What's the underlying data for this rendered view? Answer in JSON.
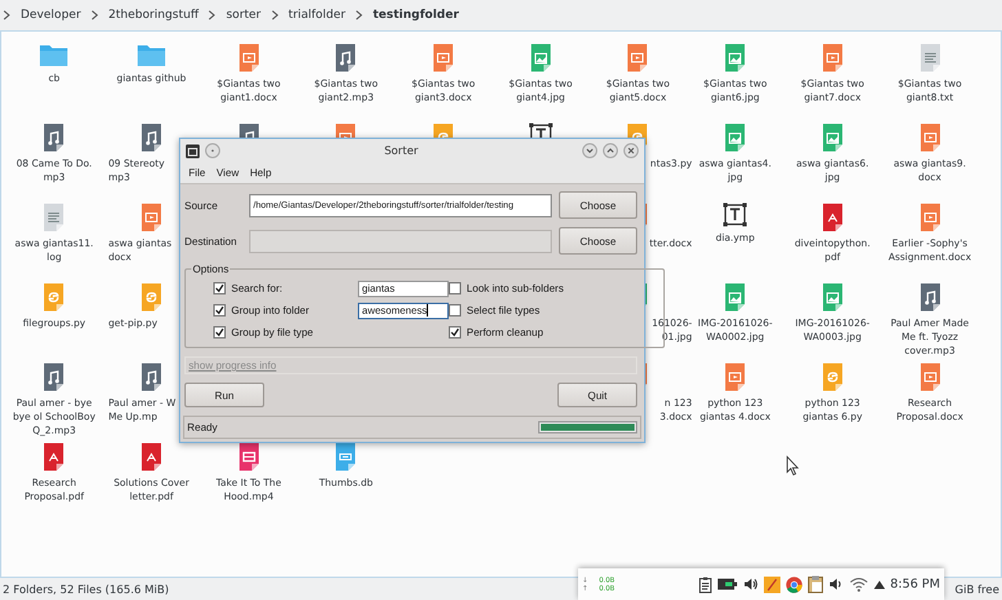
{
  "breadcrumb": [
    {
      "label": "Developer",
      "selected": false
    },
    {
      "label": "2theboringstuff",
      "selected": false
    },
    {
      "label": "sorter",
      "selected": false
    },
    {
      "label": "trialfolder",
      "selected": false
    },
    {
      "label": "testingfolder",
      "selected": true
    }
  ],
  "rows": [
    [
      {
        "kind": "folder",
        "lines": [
          "cb"
        ]
      },
      {
        "kind": "folder",
        "lines": [
          "giantas github"
        ]
      },
      {
        "kind": "docx",
        "lines": [
          "$Giantas two",
          "giant1.docx"
        ]
      },
      {
        "kind": "mp3",
        "lines": [
          "$Giantas two",
          "giant2.mp3"
        ]
      },
      {
        "kind": "docx",
        "lines": [
          "$Giantas two",
          "giant3.docx"
        ]
      },
      {
        "kind": "jpg",
        "lines": [
          "$Giantas two",
          "giant4.jpg"
        ]
      },
      {
        "kind": "docx",
        "lines": [
          "$Giantas two",
          "giant5.docx"
        ]
      },
      {
        "kind": "jpg",
        "lines": [
          "$Giantas two",
          "giant6.jpg"
        ]
      },
      {
        "kind": "docx",
        "lines": [
          "$Giantas two",
          "giant7.docx"
        ]
      },
      {
        "kind": "txt",
        "lines": [
          "$Giantas two",
          "giant8.txt"
        ]
      }
    ],
    [
      {
        "kind": "mp3",
        "lines": [
          "08 Came To Do.",
          "mp3"
        ]
      },
      {
        "kind": "mp3",
        "lines": [
          "09 Stereoty",
          "mp3"
        ]
      },
      {
        "kind": "mp3"
      },
      {
        "kind": "docx"
      },
      {
        "kind": "py"
      },
      {
        "kind": "text"
      },
      {
        "kind": "py",
        "lines": [
          "ntas3.py"
        ]
      },
      {
        "kind": "jpg",
        "lines": [
          "aswa giantas4.",
          "jpg"
        ]
      },
      {
        "kind": "jpg",
        "lines": [
          "aswa giantas6.",
          "jpg"
        ]
      },
      {
        "kind": "docx",
        "lines": [
          "aswa giantas9.",
          "docx"
        ]
      }
    ],
    [
      {
        "kind": "txt",
        "lines": [
          "aswa giantas11.",
          "log"
        ]
      },
      {
        "kind": "docx",
        "lines": [
          "aswa giantas",
          "docx"
        ]
      },
      null,
      null,
      null,
      null,
      {
        "kind": "docx",
        "lines": [
          "tter.docx"
        ]
      },
      {
        "kind": "text",
        "lines": [
          "dia.ymp"
        ]
      },
      {
        "kind": "pdf",
        "lines": [
          "diveintopython.",
          "pdf"
        ]
      },
      {
        "kind": "docx",
        "lines": [
          "Earlier -Sophy's",
          "Assignment.docx"
        ]
      }
    ],
    [
      {
        "kind": "py",
        "lines": [
          "filegroups.py"
        ]
      },
      {
        "kind": "py",
        "lines": [
          "get-pip.py"
        ]
      },
      null,
      null,
      null,
      null,
      {
        "kind": "jpg",
        "lines": [
          "161026-",
          "01.jpg"
        ]
      },
      {
        "kind": "jpg",
        "lines": [
          "IMG-20161026-",
          "WA0002.jpg"
        ]
      },
      {
        "kind": "jpg",
        "lines": [
          "IMG-20161026-",
          "WA0003.jpg"
        ]
      },
      {
        "kind": "mp3",
        "lines": [
          "Paul Amer  Made",
          "Me ft. Tyozz",
          "cover.mp3"
        ]
      }
    ],
    [
      {
        "kind": "mp3",
        "lines": [
          "Paul amer - bye",
          "bye ol SchoolBoy",
          "Q_2.mp3"
        ]
      },
      {
        "kind": "mp3",
        "lines": [
          "Paul amer - W",
          "Me Up.mp"
        ]
      },
      null,
      null,
      null,
      null,
      {
        "kind": "docx",
        "lines": [
          "n 123",
          "3.docx"
        ]
      },
      {
        "kind": "docx",
        "lines": [
          "python 123",
          "giantas 4.docx"
        ]
      },
      {
        "kind": "py",
        "lines": [
          "python 123",
          "giantas 6.py"
        ]
      },
      {
        "kind": "docx",
        "lines": [
          "Research",
          "Proposal.docx"
        ]
      }
    ],
    [
      {
        "kind": "pdf",
        "lines": [
          "Research",
          "Proposal.pdf"
        ]
      },
      {
        "kind": "pdf",
        "lines": [
          "Solutions Cover",
          "letter.pdf"
        ]
      },
      {
        "kind": "mp4",
        "lines": [
          "Take It To The",
          "Hood.mp4"
        ]
      },
      {
        "kind": "db",
        "lines": [
          "Thumbs.db"
        ]
      },
      null,
      null,
      null,
      null,
      null,
      null
    ]
  ],
  "status_bar": {
    "summary": "2 Folders, 52 Files (165.6 MiB)",
    "free_space": "GiB free"
  },
  "dialog": {
    "title": "Sorter",
    "menu": [
      "File",
      "View",
      "Help"
    ],
    "source": {
      "label": "Source",
      "value": "/home/Giantas/Developer/2theboringstuff/sorter/trialfolder/testing",
      "button": "Choose"
    },
    "destination": {
      "label": "Destination",
      "button": "Choose",
      "disabled": true
    },
    "options_title": "Options",
    "options_left": [
      {
        "kind": "checkbox-input",
        "label": "Search for:",
        "checked": true,
        "value": "giantas",
        "focused": false
      },
      {
        "kind": "checkbox-input",
        "label": "Group into folder",
        "checked": true,
        "value": "awesomeness",
        "focused": true
      },
      {
        "kind": "checkbox",
        "label": "Group by file type",
        "checked": true
      }
    ],
    "options_right": [
      {
        "kind": "checkbox",
        "label": "Look into sub-folders",
        "checked": false
      },
      {
        "kind": "checkbox",
        "label": "Select file types",
        "checked": false
      },
      {
        "kind": "checkbox",
        "label": "Perform cleanup",
        "checked": true
      }
    ],
    "progress_link": "show progress info",
    "buttons": [
      "Run",
      "Quit"
    ],
    "status": {
      "text": "Ready",
      "level": 1
    }
  },
  "tray": {
    "net": [
      {
        "arrow": "↓",
        "rate": "0.0B"
      },
      {
        "arrow": "↑",
        "rate": "0.0B"
      }
    ],
    "clock": "8:56 PM"
  }
}
